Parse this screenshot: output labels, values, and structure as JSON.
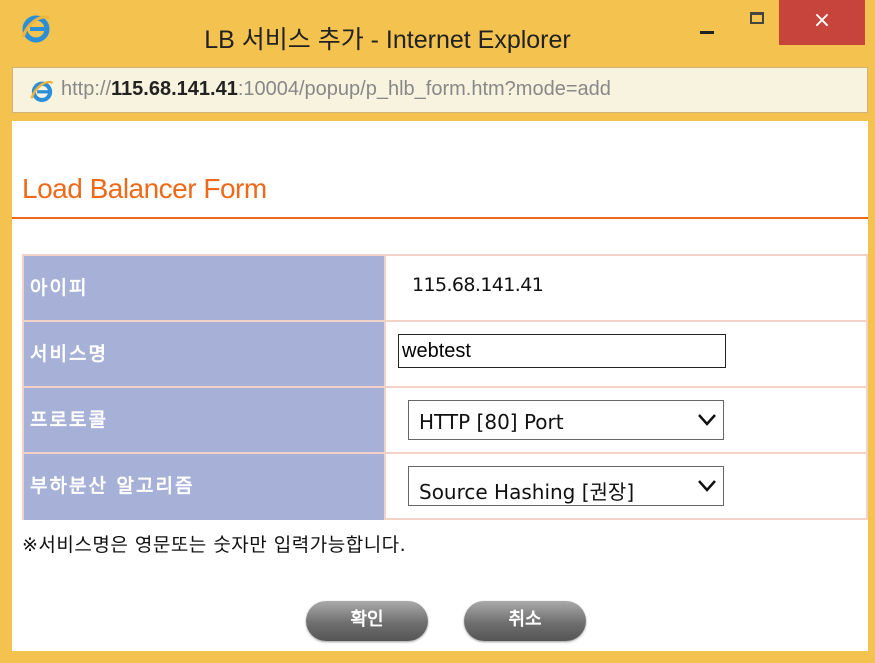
{
  "window": {
    "title": "LB 서비스 추가 - Internet Explorer",
    "close_glyph": "×"
  },
  "address": {
    "url_scheme": "http://",
    "url_host": "115.68.141.41",
    "url_rest": ":10004/popup/p_hlb_form.htm?mode=add"
  },
  "form": {
    "title": "Load Balancer Form",
    "rows": [
      {
        "label": "아이피",
        "value": "115.68.141.41"
      },
      {
        "label": "서비스명",
        "value": "webtest"
      },
      {
        "label": "프로토콜",
        "value": "HTTP [80] Port"
      },
      {
        "label": "부하분산 알고리즘",
        "value": "Source Hashing [권장]"
      }
    ],
    "note": "※서비스명은 영문또는 숫자만 입력가능합니다."
  },
  "buttons": {
    "confirm": "확인",
    "cancel": "취소"
  },
  "icons": {
    "ie": "internet-explorer-icon",
    "minimize": "minimize-icon",
    "maximize": "maximize-icon",
    "close": "close-icon",
    "dropdown": "chevron-down-icon"
  },
  "colors": {
    "frame": "#f3c24f",
    "accent": "#ee6a1a",
    "label_bg": "#a7b1d7",
    "border": "#f3d2c6",
    "close_btn": "#c6443c"
  }
}
